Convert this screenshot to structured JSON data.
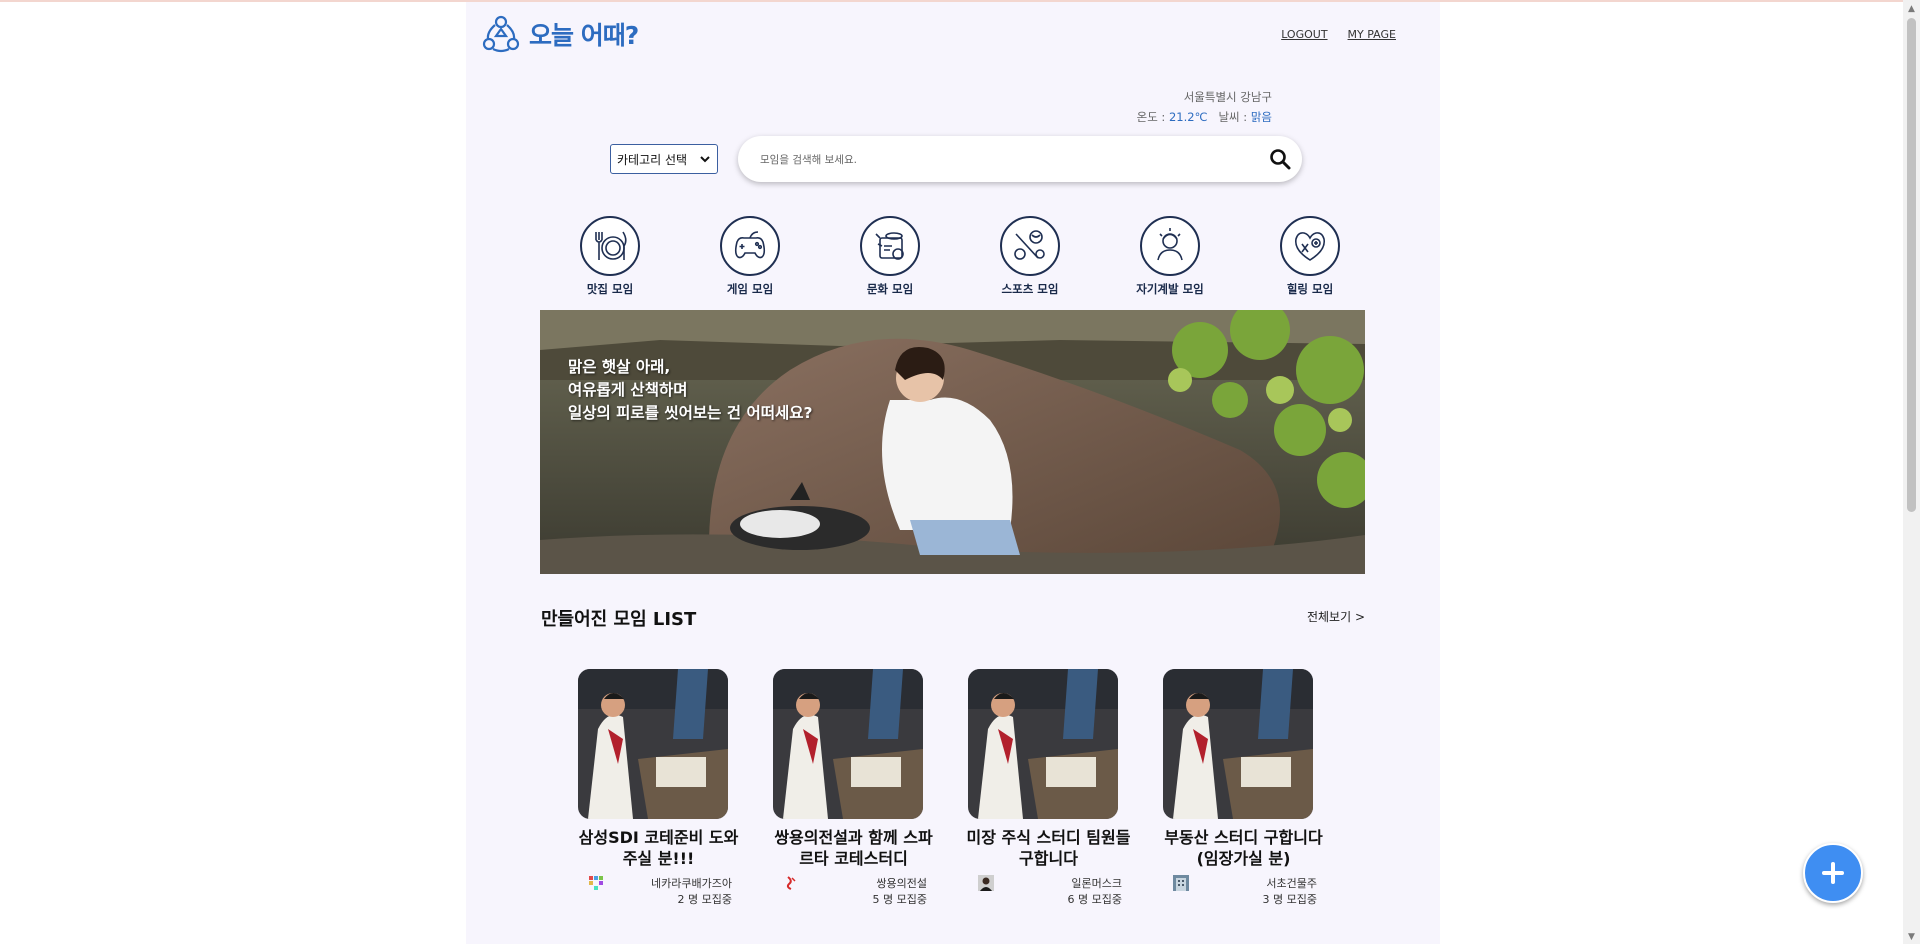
{
  "header": {
    "logo_text": "오늘 어때?",
    "logout_label": "LOGOUT",
    "mypage_label": "MY PAGE"
  },
  "weather": {
    "location": "서울특별시 강남구",
    "temp_label": "온도 : ",
    "temp_value": "21.2℃",
    "weather_label": "날씨 : ",
    "weather_value": "맑음"
  },
  "search": {
    "category_selected": "카테고리 선택",
    "placeholder": "모임을 검색해 보세요."
  },
  "categories": [
    {
      "label": "맛집 모임",
      "icon": "dining-icon"
    },
    {
      "label": "게임 모임",
      "icon": "gamepad-icon"
    },
    {
      "label": "문화 모임",
      "icon": "culture-icon"
    },
    {
      "label": "스포츠 모임",
      "icon": "sports-icon"
    },
    {
      "label": "자기계발 모임",
      "icon": "self-development-icon"
    },
    {
      "label": "힐링 모임",
      "icon": "healing-icon"
    }
  ],
  "banner": {
    "lines": [
      "맑은 햇살 아래,",
      "여유롭게 산책하며",
      "일상의 피로를 씻어보는 건 어떠세요?"
    ]
  },
  "list": {
    "title": "만들어진 모임 LIST",
    "view_all": "전체보기 >"
  },
  "cards": [
    {
      "title": "삼성SDI 코테준비 도와주실 분!!!",
      "company": "네카라쿠배가즈아",
      "count": "2 명 모집중"
    },
    {
      "title": "쌍용의전설과 함께 스파르타 코테스터디",
      "company": "쌍용의전설",
      "count": "5 명 모집중"
    },
    {
      "title": "미장 주식 스터디 팀원들 구합니다",
      "company": "일론머스크",
      "count": "6 명 모집중"
    },
    {
      "title": "부동산 스터디 구합니다(임장가실 분)",
      "company": "서초건물주",
      "count": "3 명 모집중"
    }
  ],
  "colors": {
    "brand": "#2d6cc0",
    "page_bg": "#f7f5fd",
    "fab": "#3f8ef2"
  }
}
